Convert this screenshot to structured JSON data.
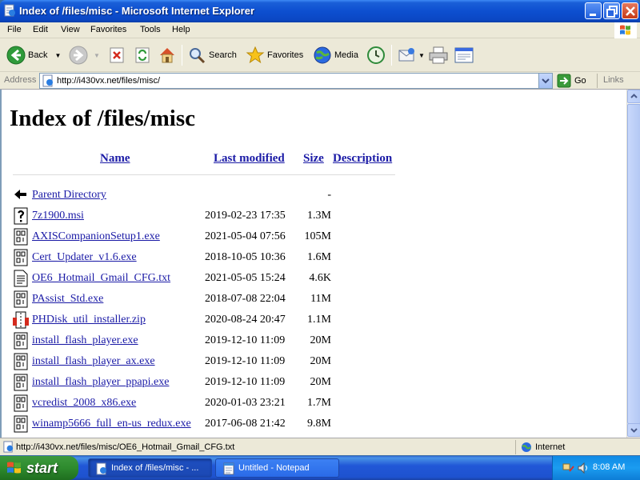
{
  "window": {
    "title": "Index of /files/misc - Microsoft Internet Explorer"
  },
  "menu": [
    "File",
    "Edit",
    "View",
    "Favorites",
    "Tools",
    "Help"
  ],
  "toolbar": {
    "back": "Back",
    "search": "Search",
    "favorites": "Favorites",
    "media": "Media"
  },
  "address": {
    "label": "Address",
    "url": "http://i430vx.net/files/misc/",
    "go": "Go",
    "links": "Links"
  },
  "page": {
    "title": "Index of /files/misc",
    "columns": {
      "name": "Name",
      "modified": "Last modified",
      "size": "Size",
      "description": "Description"
    },
    "rows": [
      {
        "icon": "back-icon",
        "name": "Parent Directory",
        "date": "",
        "size": "-"
      },
      {
        "icon": "unknown-icon",
        "name": "7z1900.msi",
        "date": "2019-02-23 17:35",
        "size": "1.3M"
      },
      {
        "icon": "binary-icon",
        "name": "AXISCompanionSetup1.exe",
        "date": "2021-05-04 07:56",
        "size": "105M"
      },
      {
        "icon": "binary-icon",
        "name": "Cert_Updater_v1.6.exe",
        "date": "2018-10-05 10:36",
        "size": "1.6M"
      },
      {
        "icon": "text-icon",
        "name": "OE6_Hotmail_Gmail_CFG.txt",
        "date": "2021-05-05 15:24",
        "size": "4.6K"
      },
      {
        "icon": "binary-icon",
        "name": "PAssist_Std.exe",
        "date": "2018-07-08 22:04",
        "size": "11M"
      },
      {
        "icon": "compressed-icon",
        "name": "PHDisk_util_installer.zip",
        "date": "2020-08-24 20:47",
        "size": "1.1M"
      },
      {
        "icon": "binary-icon",
        "name": "install_flash_player.exe",
        "date": "2019-12-10 11:09",
        "size": "20M"
      },
      {
        "icon": "binary-icon",
        "name": "install_flash_player_ax.exe",
        "date": "2019-12-10 11:09",
        "size": "20M"
      },
      {
        "icon": "binary-icon",
        "name": "install_flash_player_ppapi.exe",
        "date": "2019-12-10 11:09",
        "size": "20M"
      },
      {
        "icon": "binary-icon",
        "name": "vcredist_2008_x86.exe",
        "date": "2020-01-03 23:21",
        "size": "1.7M"
      },
      {
        "icon": "binary-icon",
        "name": "winamp5666_full_en-us_redux.exe",
        "date": "2017-06-08 21:42",
        "size": "9.8M"
      }
    ]
  },
  "status": {
    "text": "http://i430vx.net/files/misc/OE6_Hotmail_Gmail_CFG.txt",
    "zone": "Internet"
  },
  "taskbar": {
    "start": "start",
    "tasks": [
      "Index of /files/misc - ...",
      "Untitled - Notepad"
    ],
    "clock": "8:08 AM"
  }
}
